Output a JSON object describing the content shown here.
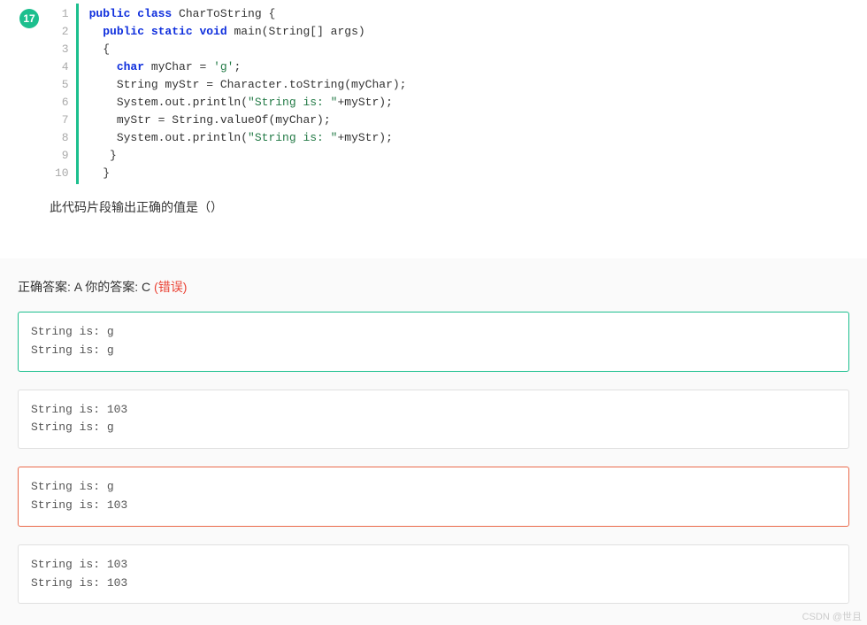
{
  "question_number": "17",
  "code_lines": [
    {
      "n": "1",
      "tokens": [
        {
          "c": "kw",
          "t": "public "
        },
        {
          "c": "kw",
          "t": "class"
        },
        {
          "t": " CharToString {"
        }
      ]
    },
    {
      "n": "2",
      "tokens": [
        {
          "t": "  "
        },
        {
          "c": "kw",
          "t": "public "
        },
        {
          "c": "kw",
          "t": "static "
        },
        {
          "c": "kw",
          "t": "void"
        },
        {
          "t": " main(String[] args)"
        }
      ]
    },
    {
      "n": "3",
      "tokens": [
        {
          "t": "  {"
        }
      ]
    },
    {
      "n": "4",
      "tokens": [
        {
          "t": "    "
        },
        {
          "c": "kw",
          "t": "char"
        },
        {
          "t": " myChar = "
        },
        {
          "c": "str",
          "t": "'g'"
        },
        {
          "t": ";"
        }
      ]
    },
    {
      "n": "5",
      "tokens": [
        {
          "t": "    String myStr = Character.toString(myChar);"
        }
      ]
    },
    {
      "n": "6",
      "tokens": [
        {
          "t": "    System.out.println("
        },
        {
          "c": "str",
          "t": "\"String is: \""
        },
        {
          "t": "+myStr);"
        }
      ]
    },
    {
      "n": "7",
      "tokens": [
        {
          "t": "    myStr = String.valueOf(myChar);"
        }
      ]
    },
    {
      "n": "8",
      "tokens": [
        {
          "t": "    System.out.println("
        },
        {
          "c": "str",
          "t": "\"String is: \""
        },
        {
          "t": "+myStr);"
        }
      ]
    },
    {
      "n": "9",
      "tokens": [
        {
          "t": "   }"
        }
      ]
    },
    {
      "n": "10",
      "tokens": [
        {
          "t": "  }"
        }
      ]
    }
  ],
  "question_text": "此代码片段输出正确的值是（）",
  "answer_label": {
    "correct_prefix": "正确答案: ",
    "correct_value": "A",
    "your_prefix": "  你的答案: ",
    "your_value": "C",
    "wrong_text": " (错误)"
  },
  "options": [
    {
      "state": "correct",
      "text": "String is: g\nString is: g"
    },
    {
      "state": "",
      "text": "String is: 103\nString is: g"
    },
    {
      "state": "selected-wrong",
      "text": "String is: g\nString is: 103"
    },
    {
      "state": "",
      "text": "String is: 103\nString is: 103"
    }
  ],
  "watermark": "CSDN @世且"
}
